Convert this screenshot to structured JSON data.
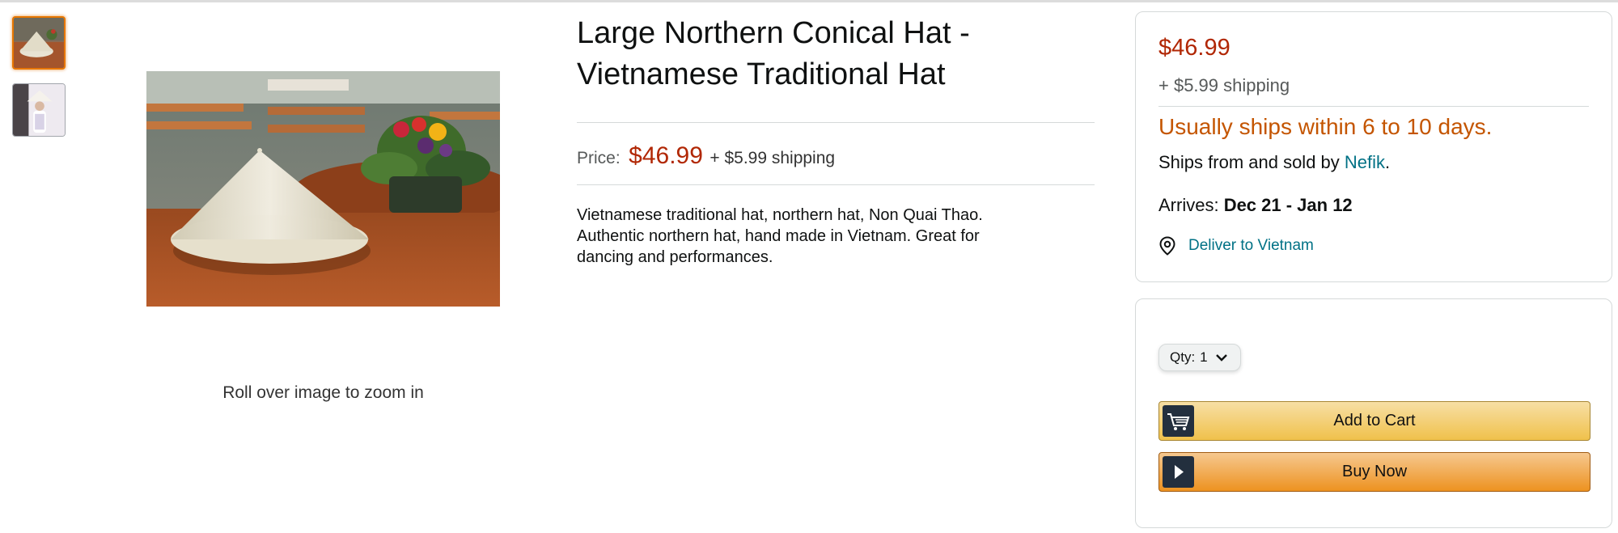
{
  "gallery": {
    "thumbnails": [
      {
        "icon": "hat-photo-thumbnail",
        "selected": true
      },
      {
        "icon": "person-photo-thumbnail",
        "selected": false
      }
    ],
    "main_image_icon": "conical-hat-photo",
    "zoom_hint": "Roll over image to zoom in"
  },
  "product": {
    "title": "Large Northern Conical Hat - Vietnamese Traditional Hat",
    "price_label": "Price:",
    "price": "$46.99",
    "shipping": "+ $5.99 shipping",
    "description": "Vietnamese traditional hat, northern hat, Non Quai Thao. Authentic northern hat, hand made in Vietnam. Great for dancing and performances."
  },
  "buybox": {
    "price": "$46.99",
    "shipping": "+ $5.99 shipping",
    "availability": "Usually ships within 6 to 10 days.",
    "sold_by_prefix": "Ships from and sold by ",
    "seller": "Nefik",
    "sold_by_suffix": ".",
    "arrives_label": "Arrives:",
    "arrives_dates": "Dec 21 - Jan 12",
    "deliver_icon": "location-pin-icon",
    "deliver_to": "Deliver to Vietnam"
  },
  "purchase": {
    "qty_label": "Qty:",
    "qty_value": "1",
    "add_to_cart": "Add to Cart",
    "buy_now": "Buy Now",
    "cart_icon": "cart-icon",
    "buy_now_icon": "play-icon"
  },
  "colors": {
    "price_red": "#b12704",
    "availability_orange": "#c45500",
    "link_teal": "#007185",
    "add_to_cart_yellow": "#f0c14b",
    "buy_now_orange": "#ed9220"
  }
}
